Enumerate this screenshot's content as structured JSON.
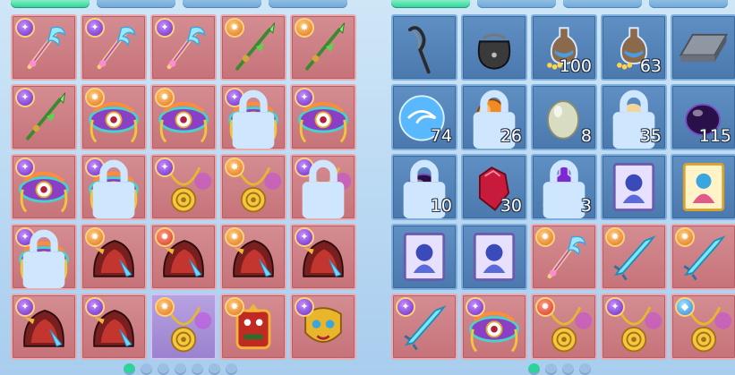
{
  "left_inventory": {
    "slots": [
      {
        "item": "feather-staff",
        "bg": "red",
        "badge": "purple",
        "locked": false,
        "qty": ""
      },
      {
        "item": "feather-staff",
        "bg": "red",
        "badge": "purple",
        "locked": false,
        "qty": ""
      },
      {
        "item": "feather-staff",
        "bg": "red",
        "badge": "purple",
        "locked": false,
        "qty": ""
      },
      {
        "item": "jade-spear",
        "bg": "red",
        "badge": "orange",
        "locked": false,
        "qty": ""
      },
      {
        "item": "jade-spear",
        "bg": "red",
        "badge": "orange",
        "locked": false,
        "qty": ""
      },
      {
        "item": "jade-spear",
        "bg": "red",
        "badge": "purple",
        "locked": false,
        "qty": ""
      },
      {
        "item": "eye-crown",
        "bg": "red",
        "badge": "orange",
        "locked": false,
        "qty": ""
      },
      {
        "item": "eye-crown",
        "bg": "red",
        "badge": "orange",
        "locked": false,
        "qty": ""
      },
      {
        "item": "eye-crown",
        "bg": "red",
        "badge": "purple",
        "locked": true,
        "qty": ""
      },
      {
        "item": "eye-crown",
        "bg": "red",
        "badge": "purple",
        "locked": false,
        "qty": ""
      },
      {
        "item": "eye-crown",
        "bg": "red",
        "badge": "purple",
        "locked": false,
        "qty": ""
      },
      {
        "item": "eye-crown",
        "bg": "red",
        "badge": "purple",
        "locked": true,
        "qty": ""
      },
      {
        "item": "gold-amulet",
        "bg": "red",
        "badge": "purple",
        "locked": false,
        "qty": ""
      },
      {
        "item": "gold-amulet",
        "bg": "red",
        "badge": "orange",
        "locked": false,
        "qty": ""
      },
      {
        "item": "gold-amulet",
        "bg": "red",
        "badge": "purple",
        "locked": true,
        "qty": ""
      },
      {
        "item": "eye-crown",
        "bg": "red",
        "badge": "purple",
        "locked": true,
        "qty": ""
      },
      {
        "item": "dragon-helm",
        "bg": "red",
        "badge": "orange",
        "locked": false,
        "qty": ""
      },
      {
        "item": "dragon-helm",
        "bg": "red",
        "badge": "red",
        "locked": false,
        "qty": ""
      },
      {
        "item": "dragon-helm",
        "bg": "red",
        "badge": "orange",
        "locked": false,
        "qty": ""
      },
      {
        "item": "dragon-helm",
        "bg": "red",
        "badge": "purple",
        "locked": false,
        "qty": ""
      },
      {
        "item": "dragon-helm",
        "bg": "red",
        "badge": "purple",
        "locked": false,
        "qty": ""
      },
      {
        "item": "dragon-helm",
        "bg": "red",
        "badge": "purple",
        "locked": false,
        "qty": ""
      },
      {
        "item": "gold-amulet",
        "bg": "purple",
        "badge": "orange",
        "locked": false,
        "qty": ""
      },
      {
        "item": "totem-armor",
        "bg": "red",
        "badge": "orange",
        "locked": false,
        "qty": ""
      },
      {
        "item": "golden-mask",
        "bg": "red",
        "badge": "purple",
        "locked": false,
        "qty": ""
      }
    ]
  },
  "right_inventory": {
    "slots": [
      {
        "item": "slingshot",
        "bg": "blue",
        "badge": "",
        "locked": false,
        "qty": ""
      },
      {
        "item": "pouch",
        "bg": "blue",
        "badge": "",
        "locked": false,
        "qty": ""
      },
      {
        "item": "potion-flask",
        "bg": "blue",
        "badge": "",
        "locked": false,
        "qty": "100"
      },
      {
        "item": "potion-flask",
        "bg": "blue",
        "badge": "",
        "locked": false,
        "qty": "63"
      },
      {
        "item": "silver-bar",
        "bg": "blue",
        "badge": "",
        "locked": false,
        "qty": ""
      },
      {
        "item": "blue-orb",
        "bg": "blue",
        "badge": "",
        "locked": false,
        "qty": "74"
      },
      {
        "item": "orange-egg",
        "bg": "blue",
        "badge": "",
        "locked": true,
        "qty": "26"
      },
      {
        "item": "pale-egg",
        "bg": "blue",
        "badge": "",
        "locked": false,
        "qty": "8"
      },
      {
        "item": "gem-cluster",
        "bg": "blue",
        "badge": "",
        "locked": true,
        "qty": "35"
      },
      {
        "item": "dark-egg",
        "bg": "blue",
        "badge": "",
        "locked": false,
        "qty": "115"
      },
      {
        "item": "dark-egg",
        "bg": "blue",
        "badge": "",
        "locked": true,
        "qty": "10"
      },
      {
        "item": "red-gem",
        "bg": "blue",
        "badge": "",
        "locked": false,
        "qty": "30"
      },
      {
        "item": "magic-vial",
        "bg": "blue",
        "badge": "",
        "locked": true,
        "qty": "3"
      },
      {
        "item": "card-frame",
        "bg": "blue",
        "badge": "",
        "locked": false,
        "qty": ""
      },
      {
        "item": "card-frame-gold",
        "bg": "blue",
        "badge": "",
        "locked": false,
        "qty": ""
      },
      {
        "item": "card-frame",
        "bg": "blue",
        "badge": "",
        "locked": false,
        "qty": ""
      },
      {
        "item": "card-frame",
        "bg": "blue",
        "badge": "",
        "locked": false,
        "qty": ""
      },
      {
        "item": "feather-staff",
        "bg": "red",
        "badge": "orange",
        "locked": false,
        "qty": ""
      },
      {
        "item": "crystal-sword",
        "bg": "red",
        "badge": "orange",
        "locked": false,
        "qty": ""
      },
      {
        "item": "crystal-sword",
        "bg": "red",
        "badge": "orange",
        "locked": false,
        "qty": ""
      },
      {
        "item": "crystal-sword",
        "bg": "red",
        "badge": "purple",
        "locked": false,
        "qty": ""
      },
      {
        "item": "eye-crown",
        "bg": "red",
        "badge": "purple",
        "locked": false,
        "qty": ""
      },
      {
        "item": "gold-amulet",
        "bg": "red",
        "badge": "red",
        "locked": false,
        "qty": ""
      },
      {
        "item": "gold-amulet",
        "bg": "red",
        "badge": "purple",
        "locked": false,
        "qty": ""
      },
      {
        "item": "gold-amulet",
        "bg": "red",
        "badge": "blue",
        "locked": false,
        "qty": ""
      }
    ]
  },
  "left_pager": {
    "pages": 7,
    "active": 0
  },
  "right_pager": {
    "pages": 4,
    "active": 0
  }
}
